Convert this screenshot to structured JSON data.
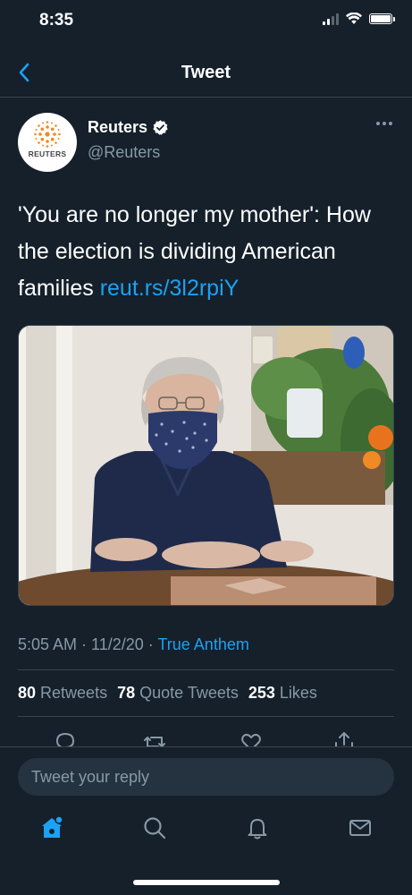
{
  "status_bar": {
    "time": "8:35"
  },
  "nav": {
    "title": "Tweet"
  },
  "author": {
    "name": "Reuters",
    "handle": "@Reuters",
    "avatar_text": "REUTERS",
    "verified": true
  },
  "tweet": {
    "text": "'You are no longer my mother': How the election is dividing American families ",
    "link": "reut.rs/3l2rpiY"
  },
  "meta": {
    "time": "5:05 AM",
    "date": "11/2/20",
    "source": "True Anthem"
  },
  "stats": {
    "retweets_count": "80",
    "retweets_label": "Retweets",
    "quotes_count": "78",
    "quotes_label": "Quote Tweets",
    "likes_count": "253",
    "likes_label": "Likes"
  },
  "reply": {
    "placeholder": "Tweet your reply"
  },
  "icons": {
    "back": "chevron-left-icon",
    "verified": "verified-badge-icon",
    "more": "more-horizontal-icon",
    "reply": "reply-icon",
    "retweet": "retweet-icon",
    "like": "heart-icon",
    "share": "share-icon",
    "home": "home-icon",
    "search": "search-icon",
    "notifications": "bell-icon",
    "messages": "mail-icon"
  },
  "colors": {
    "background": "#15202b",
    "accent": "#1da1f2",
    "secondary_text": "#8899a6",
    "divider": "#38444d"
  }
}
